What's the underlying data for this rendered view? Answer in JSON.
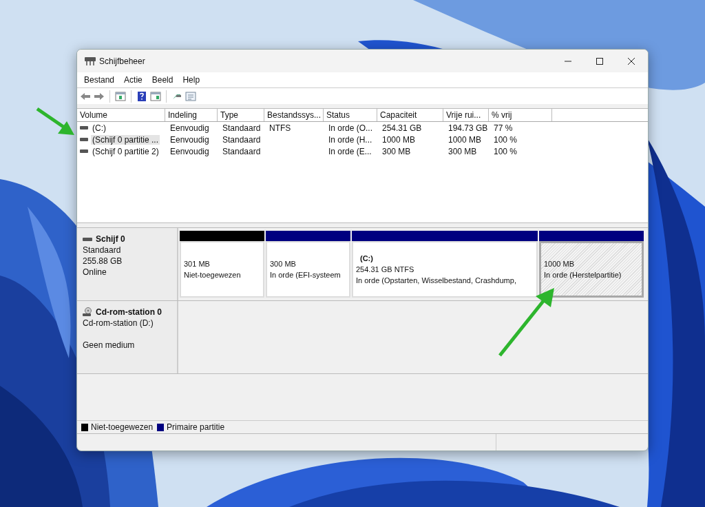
{
  "window": {
    "title": "Schijfbeheer"
  },
  "menu": [
    "Bestand",
    "Actie",
    "Beeld",
    "Help"
  ],
  "table": {
    "columns": [
      "Volume",
      "Indeling",
      "Type",
      "Bestandssys...",
      "Status",
      "Capaciteit",
      "Vrije rui...",
      "% vrij"
    ],
    "rows": [
      {
        "selected": false,
        "cells": [
          "(C:)",
          "Eenvoudig",
          "Standaard",
          "NTFS",
          "In orde (O...",
          "254.31 GB",
          "194.73 GB",
          "77 %"
        ]
      },
      {
        "selected": true,
        "cells": [
          "(Schijf 0 partitie ...",
          "Eenvoudig",
          "Standaard",
          "",
          "In orde (H...",
          "1000 MB",
          "1000 MB",
          "100 %"
        ]
      },
      {
        "selected": false,
        "cells": [
          "(Schijf 0 partitie 2)",
          "Eenvoudig",
          "Standaard",
          "",
          "In orde (E...",
          "300 MB",
          "300 MB",
          "100 %"
        ]
      }
    ]
  },
  "disks": [
    {
      "kind": "disk",
      "name": "Schijf 0",
      "type": "Standaard",
      "size": "255.88 GB",
      "state": "Online",
      "partitions": [
        {
          "color": "#000000",
          "selected": false,
          "size": "301 MB",
          "status": "Niet-toegewezen"
        },
        {
          "color": "#000080",
          "selected": false,
          "size": "300 MB",
          "status": "In orde (EFI-systeem"
        },
        {
          "color": "#000080",
          "selected": false,
          "label": "(C:)",
          "size": "254.31 GB NTFS",
          "status": "In orde (Opstarten, Wisselbestand, Crashdump,"
        },
        {
          "color": "#000080",
          "selected": true,
          "size": "1000 MB",
          "status": "In orde (Herstelpartitie)"
        }
      ]
    },
    {
      "kind": "cdrom",
      "name": "Cd-rom-station 0",
      "type": "Cd-rom-station (D:)",
      "state": "Geen medium"
    }
  ],
  "legend": [
    {
      "color": "#000000",
      "label": "Niet-toegewezen"
    },
    {
      "color": "#000080",
      "label": "Primaire partitie"
    }
  ]
}
